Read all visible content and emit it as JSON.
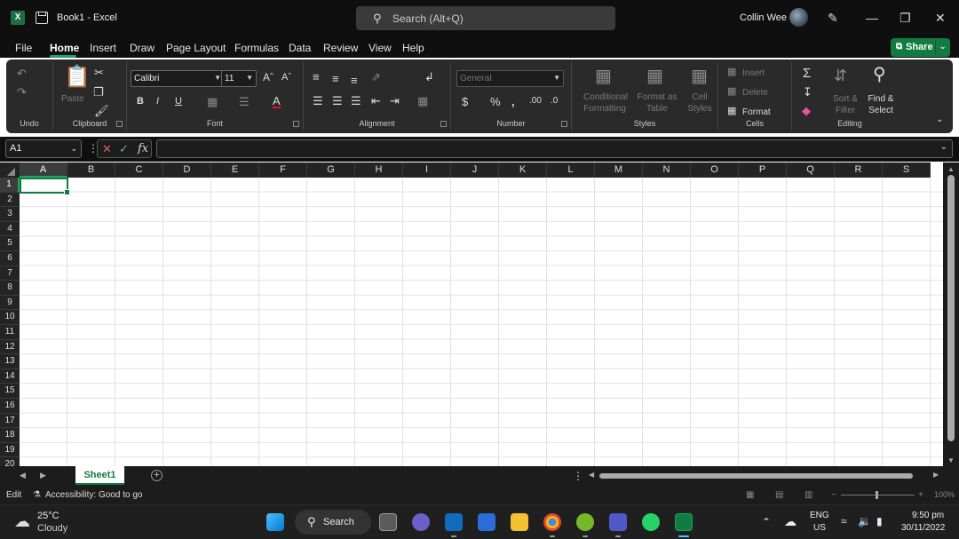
{
  "window": {
    "title": "Book1 - Excel",
    "app_icon": "excel-logo-icon",
    "search_placeholder": "Search (Alt+Q)",
    "user": "Collin Wee"
  },
  "menu": {
    "items": [
      "File",
      "Home",
      "Insert",
      "Draw",
      "Page Layout",
      "Formulas",
      "Data",
      "Review",
      "View",
      "Help"
    ],
    "active": "Home",
    "share": "Share"
  },
  "ribbon": {
    "groups": {
      "undo": "Undo",
      "clipboard": "Clipboard",
      "font": "Font",
      "alignment": "Alignment",
      "number": "Number",
      "styles": "Styles",
      "cells": "Cells",
      "editing": "Editing"
    },
    "paste": "Paste",
    "font_name": "Calibri",
    "font_size": "11",
    "number_format": "General",
    "conditional_formatting": [
      "Conditional",
      "Formatting"
    ],
    "format_as_table": [
      "Format as",
      "Table"
    ],
    "cell_styles": [
      "Cell",
      "Styles"
    ],
    "insert": "Insert",
    "delete": "Delete",
    "format": "Format",
    "sort_filter": [
      "Sort &",
      "Filter"
    ],
    "find_select": [
      "Find &",
      "Select"
    ]
  },
  "formula_bar": {
    "name_box": "A1",
    "formula": "",
    "fx_label": "fx"
  },
  "grid": {
    "columns": [
      "A",
      "B",
      "C",
      "D",
      "E",
      "F",
      "G",
      "H",
      "I",
      "J",
      "K",
      "L",
      "M",
      "N",
      "O",
      "P",
      "Q",
      "R",
      "S"
    ],
    "rows": [
      "1",
      "2",
      "3",
      "4",
      "5",
      "6",
      "7",
      "8",
      "9",
      "10",
      "11",
      "12",
      "13",
      "14",
      "15",
      "16",
      "17",
      "18",
      "19",
      "20"
    ],
    "active_cell": "A1"
  },
  "sheets": {
    "tabs": [
      "Sheet1"
    ],
    "active": "Sheet1"
  },
  "status": {
    "mode": "Edit",
    "accessibility": "Accessibility: Good to go",
    "zoom": "100%"
  },
  "taskbar": {
    "weather_temp": "25°C",
    "weather_desc": "Cloudy",
    "search": "Search",
    "language": "ENG",
    "region": "US",
    "time": "9:50 pm",
    "date": "30/11/2022"
  },
  "colors": {
    "accent": "#107c41",
    "share": "#107c41",
    "titlebar": "#0f0f0f",
    "ribbon": "#2a2a2a"
  }
}
